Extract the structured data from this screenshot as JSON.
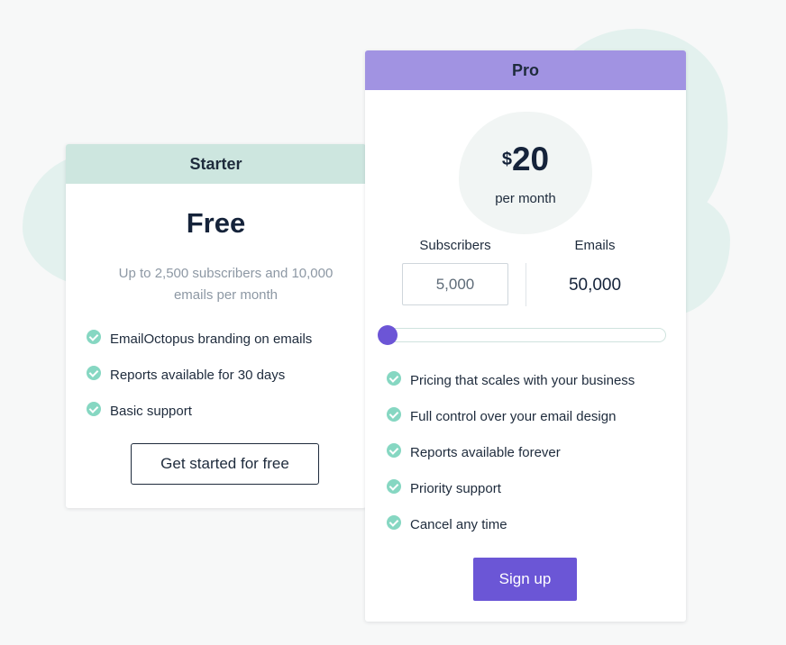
{
  "colors": {
    "background": "#f7f8f8",
    "blob": "#e3f1ee",
    "starter_header": "#cde6df",
    "pro_header": "#a193e2",
    "check": "#86d7c2",
    "primary": "#6b56d6",
    "slider_thumb": "#6c55d6",
    "text": "#1e2b3c",
    "muted": "#8d98a4"
  },
  "starter": {
    "header": "Starter",
    "price_title": "Free",
    "description": "Up to 2,500 subscribers and 10,000 emails per month",
    "features": [
      {
        "icon": "check-circle-icon",
        "label": "EmailOctopus branding on emails"
      },
      {
        "icon": "check-circle-icon",
        "label": "Reports available for 30 days"
      },
      {
        "icon": "check-circle-icon",
        "label": "Basic support"
      }
    ],
    "cta_label": "Get started for free"
  },
  "pro": {
    "header": "Pro",
    "currency": "$",
    "amount": "20",
    "period": "per month",
    "subscribers_label": "Subscribers",
    "emails_label": "Emails",
    "subscribers_value": "5,000",
    "emails_value": "50,000",
    "slider_value_fraction": 0,
    "features": [
      {
        "icon": "check-circle-icon",
        "label": "Pricing that scales with your business"
      },
      {
        "icon": "check-circle-icon",
        "label": "Full control over your email design"
      },
      {
        "icon": "check-circle-icon",
        "label": "Reports available forever"
      },
      {
        "icon": "check-circle-icon",
        "label": "Priority support"
      },
      {
        "icon": "check-circle-icon",
        "label": "Cancel any time"
      }
    ],
    "cta_label": "Sign up"
  }
}
